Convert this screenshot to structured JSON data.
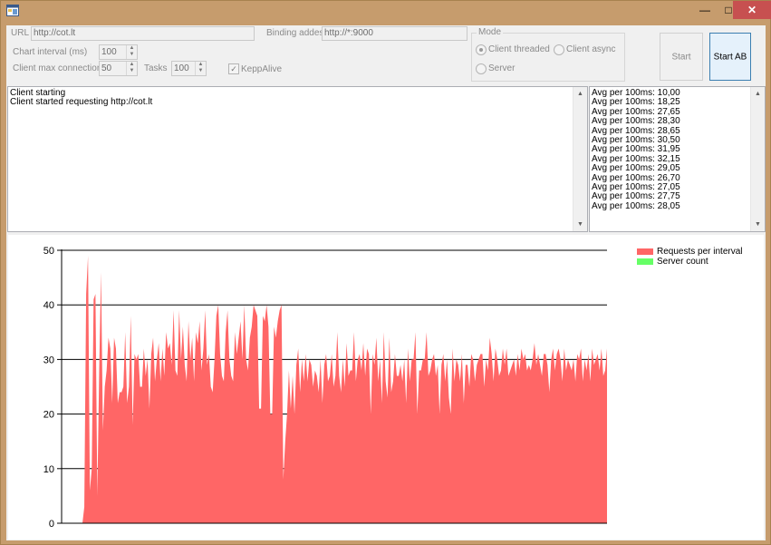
{
  "form": {
    "url_label": "URL",
    "url_value": "http://cot.lt",
    "binding_label": "Binding addess",
    "binding_value": "http://*:9000",
    "interval_label": "Chart interval (ms)",
    "interval_value": "100",
    "connections_label": "Client max connections",
    "connections_value": "50",
    "tasks_label": "Tasks",
    "tasks_value": "100",
    "keepalive_label": "KeppAlive",
    "keepalive_checked": true
  },
  "mode": {
    "title": "Mode",
    "options": [
      {
        "label": "Client threaded",
        "selected": true
      },
      {
        "label": "Client async",
        "selected": false
      },
      {
        "label": "Server",
        "selected": false
      }
    ]
  },
  "buttons": {
    "start": "Start",
    "start_ab": "Start AB"
  },
  "log": [
    "Client starting",
    "Client started requesting http://cot.lt"
  ],
  "averages": [
    "Avg per 100ms: 10,00",
    "Avg per 100ms: 18,25",
    "Avg per 100ms: 27,65",
    "Avg per 100ms: 28,30",
    "Avg per 100ms: 28,65",
    "Avg per 100ms: 30,50",
    "Avg per 100ms: 31,95",
    "Avg per 100ms: 32,15",
    "Avg per 100ms: 29,05",
    "Avg per 100ms: 26,70",
    "Avg per 100ms: 27,05",
    "Avg per 100ms: 27,75",
    "Avg per 100ms: 28,05"
  ],
  "chart_data": {
    "type": "area",
    "ylim": [
      0,
      50
    ],
    "yticks": [
      0,
      10,
      20,
      30,
      40,
      50
    ],
    "grid": true,
    "legend_position": "top-right",
    "series": [
      {
        "name": "Requests per interval",
        "color": "#ff6666",
        "values": [
          0,
          3,
          42,
          49,
          6,
          10,
          41,
          42,
          5,
          28,
          46,
          17,
          25,
          28,
          34,
          32,
          22,
          34,
          32,
          22,
          24,
          24,
          25,
          35,
          22,
          25,
          38,
          18,
          31,
          30,
          31,
          25,
          25,
          32,
          27,
          30,
          21,
          31,
          34,
          26,
          30,
          33,
          26,
          32,
          27,
          35,
          32,
          33,
          29,
          39,
          28,
          27,
          39,
          30,
          36,
          29,
          26,
          37,
          30,
          34,
          26,
          35,
          33,
          37,
          28,
          32,
          39,
          29,
          31,
          25,
          24,
          30,
          38,
          40,
          31,
          27,
          26,
          35,
          39,
          30,
          27,
          26,
          35,
          31,
          34,
          37,
          30,
          40,
          30,
          28,
          34,
          36,
          40,
          39,
          38,
          21,
          21,
          38,
          37,
          40,
          36,
          20,
          20,
          36,
          34,
          37,
          39,
          40,
          8,
          15,
          20,
          28,
          21,
          27,
          20,
          29,
          32,
          24,
          30,
          26,
          31,
          26,
          30,
          29,
          25,
          28,
          27,
          24,
          30,
          22,
          29,
          31,
          26,
          27,
          31,
          25,
          27,
          35,
          27,
          24,
          30,
          25,
          33,
          27,
          28,
          28,
          35,
          26,
          30,
          31,
          28,
          33,
          27,
          32,
          31,
          20,
          31,
          29,
          34,
          26,
          30,
          22,
          35,
          26,
          23,
          34,
          24,
          26,
          31,
          27,
          27,
          29,
          26,
          30,
          22,
          32,
          26,
          30,
          30,
          35,
          20,
          28,
          28,
          30,
          30,
          35,
          27,
          28,
          30,
          31,
          27,
          29,
          20,
          29,
          31,
          26,
          30,
          23,
          20,
          32,
          26,
          30,
          29,
          26,
          31,
          22,
          29,
          29,
          25,
          31,
          30,
          26,
          29,
          30,
          31,
          31,
          25,
          30,
          28,
          34,
          31,
          26,
          32,
          30,
          27,
          28,
          32,
          29,
          32,
          27,
          28,
          29,
          30,
          27,
          31,
          28,
          32,
          30,
          31,
          28,
          29,
          28,
          30,
          33,
          29,
          31,
          29,
          27,
          31,
          31,
          29,
          24,
          30,
          32,
          28,
          31,
          32,
          30,
          26,
          32,
          28,
          30,
          29,
          28,
          30,
          26,
          31,
          30,
          32,
          26,
          30,
          28,
          31,
          26,
          32,
          29,
          30,
          31,
          28,
          32,
          27,
          28,
          32
        ]
      },
      {
        "name": "Server count",
        "color": "#66ff66",
        "values": []
      }
    ]
  }
}
